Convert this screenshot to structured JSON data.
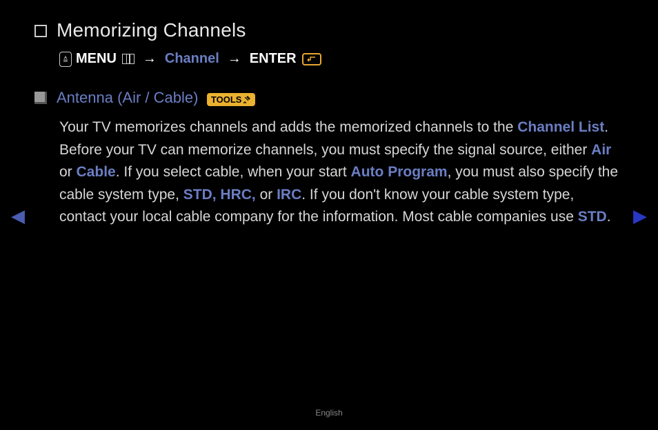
{
  "title": "Memorizing Channels",
  "nav": {
    "menu": "MENU",
    "channel": "Channel",
    "enter": "ENTER"
  },
  "section": {
    "heading": "Antenna (Air / Cable)",
    "tools": "TOOLS"
  },
  "body": {
    "t1": "Your TV memorizes channels and adds the memorized channels to the ",
    "channel_list": "Channel List",
    "t2": ". Before your TV can memorize channels, you must specify the signal source, either ",
    "air": "Air",
    "t3": " or ",
    "cable": "Cable",
    "t4": ". If you select cable, when your start ",
    "auto_program": "Auto Program",
    "t5": ", you must also specify the cable system type, ",
    "std_hrc": "STD, HRC,",
    "t6": " or ",
    "irc": "IRC",
    "t7": ". If you don't know your cable system type, contact your local cable company for the information. Most cable companies use ",
    "std": "STD",
    "t8": "."
  },
  "footer": "English"
}
